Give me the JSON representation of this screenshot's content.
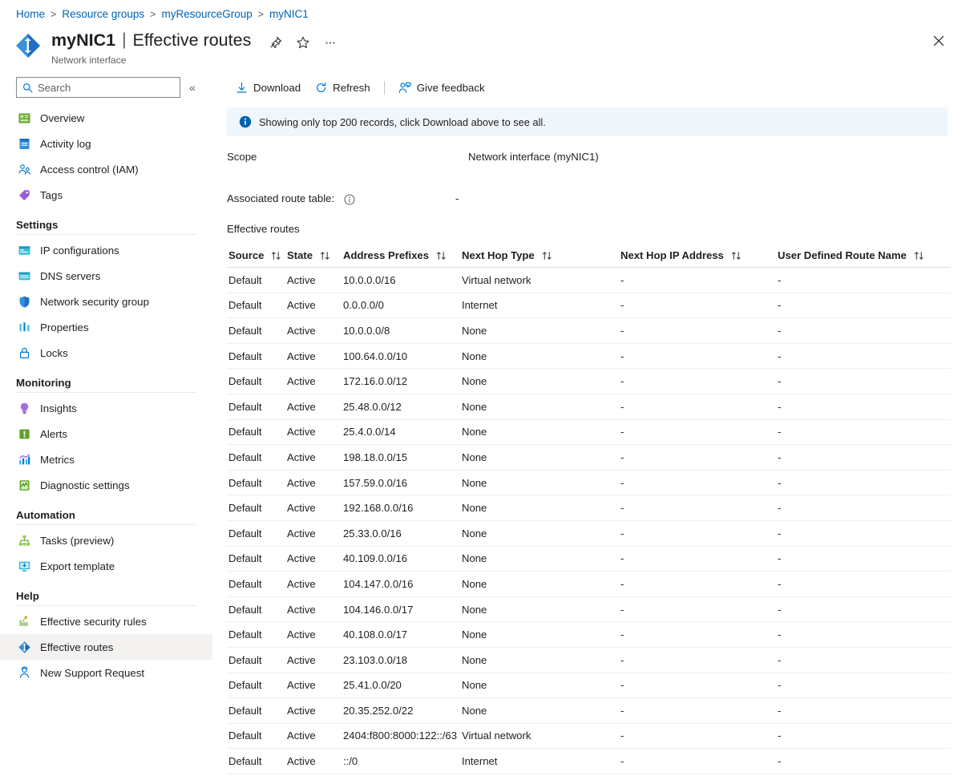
{
  "breadcrumb": {
    "items": [
      "Home",
      "Resource groups",
      "myResourceGroup",
      "myNIC1"
    ],
    "separator": ">"
  },
  "header": {
    "resource_name": "myNIC1",
    "separator": "|",
    "page_title": "Effective routes",
    "subtitle": "Network interface",
    "resource_icon": "network-interface-icon",
    "actions": [
      {
        "name": "pin-icon",
        "label": "Pin"
      },
      {
        "name": "favorite-star-icon",
        "label": "Add to favorites"
      },
      {
        "name": "more-ellipsis-icon",
        "label": "More"
      }
    ],
    "close_label": "Close"
  },
  "sidebar": {
    "search": {
      "placeholder": "Search",
      "value": "",
      "icon": "search-icon"
    },
    "collapse_icon": "chevron-double-left-icon",
    "items": [
      {
        "label": "Overview",
        "icon": "overview-icon",
        "type": "item",
        "selected": false
      },
      {
        "label": "Activity log",
        "icon": "activity-log-icon",
        "type": "item",
        "selected": false
      },
      {
        "label": "Access control (IAM)",
        "icon": "access-control-icon",
        "type": "item",
        "selected": false
      },
      {
        "label": "Tags",
        "icon": "tags-icon",
        "type": "item",
        "selected": false
      },
      {
        "label": "Settings",
        "type": "group"
      },
      {
        "label": "IP configurations",
        "icon": "ip-configurations-icon",
        "type": "item",
        "selected": false
      },
      {
        "label": "DNS servers",
        "icon": "dns-servers-icon",
        "type": "item",
        "selected": false
      },
      {
        "label": "Network security group",
        "icon": "shield-icon",
        "type": "item",
        "selected": false
      },
      {
        "label": "Properties",
        "icon": "properties-icon",
        "type": "item",
        "selected": false
      },
      {
        "label": "Locks",
        "icon": "lock-icon",
        "type": "item",
        "selected": false
      },
      {
        "label": "Monitoring",
        "type": "group"
      },
      {
        "label": "Insights",
        "icon": "insights-icon",
        "type": "item",
        "selected": false
      },
      {
        "label": "Alerts",
        "icon": "alerts-icon",
        "type": "item",
        "selected": false
      },
      {
        "label": "Metrics",
        "icon": "metrics-icon",
        "type": "item",
        "selected": false
      },
      {
        "label": "Diagnostic settings",
        "icon": "diagnostic-settings-icon",
        "type": "item",
        "selected": false
      },
      {
        "label": "Automation",
        "type": "group"
      },
      {
        "label": "Tasks (preview)",
        "icon": "tasks-icon",
        "type": "item",
        "selected": false
      },
      {
        "label": "Export template",
        "icon": "export-template-icon",
        "type": "item",
        "selected": false
      },
      {
        "label": "Help",
        "type": "group"
      },
      {
        "label": "Effective security rules",
        "icon": "effective-security-rules-icon",
        "type": "item",
        "selected": false
      },
      {
        "label": "Effective routes",
        "icon": "effective-routes-icon",
        "type": "item",
        "selected": true
      },
      {
        "label": "New Support Request",
        "icon": "support-request-icon",
        "type": "item",
        "selected": false
      }
    ]
  },
  "toolbar": {
    "download_label": "Download",
    "download_icon": "download-icon",
    "refresh_label": "Refresh",
    "refresh_icon": "refresh-icon",
    "feedback_label": "Give feedback",
    "feedback_icon": "feedback-person-icon"
  },
  "banner": {
    "icon": "info-icon",
    "text": "Showing only top 200 records, click Download above to see all."
  },
  "details": {
    "scope_label": "Scope",
    "scope_value": "Network interface (myNIC1)",
    "route_table_label": "Associated route table:",
    "route_table_info_icon": "info-outline-icon",
    "route_table_value": "-",
    "section_title": "Effective routes"
  },
  "table": {
    "columns": [
      {
        "label": "Source",
        "sort_icon": "sort-updown-icon"
      },
      {
        "label": "State",
        "sort_icon": "sort-updown-icon"
      },
      {
        "label": "Address Prefixes",
        "sort_icon": "sort-updown-icon"
      },
      {
        "label": "Next Hop Type",
        "sort_icon": "sort-updown-icon"
      },
      {
        "label": "Next Hop IP Address",
        "sort_icon": "sort-updown-icon"
      },
      {
        "label": "User Defined Route Name",
        "sort_icon": "sort-updown-icon"
      }
    ],
    "rows": [
      [
        "Default",
        "Active",
        "10.0.0.0/16",
        "Virtual network",
        "-",
        "-"
      ],
      [
        "Default",
        "Active",
        "0.0.0.0/0",
        "Internet",
        "-",
        "-"
      ],
      [
        "Default",
        "Active",
        "10.0.0.0/8",
        "None",
        "-",
        "-"
      ],
      [
        "Default",
        "Active",
        "100.64.0.0/10",
        "None",
        "-",
        "-"
      ],
      [
        "Default",
        "Active",
        "172.16.0.0/12",
        "None",
        "-",
        "-"
      ],
      [
        "Default",
        "Active",
        "25.48.0.0/12",
        "None",
        "-",
        "-"
      ],
      [
        "Default",
        "Active",
        "25.4.0.0/14",
        "None",
        "-",
        "-"
      ],
      [
        "Default",
        "Active",
        "198.18.0.0/15",
        "None",
        "-",
        "-"
      ],
      [
        "Default",
        "Active",
        "157.59.0.0/16",
        "None",
        "-",
        "-"
      ],
      [
        "Default",
        "Active",
        "192.168.0.0/16",
        "None",
        "-",
        "-"
      ],
      [
        "Default",
        "Active",
        "25.33.0.0/16",
        "None",
        "-",
        "-"
      ],
      [
        "Default",
        "Active",
        "40.109.0.0/16",
        "None",
        "-",
        "-"
      ],
      [
        "Default",
        "Active",
        "104.147.0.0/16",
        "None",
        "-",
        "-"
      ],
      [
        "Default",
        "Active",
        "104.146.0.0/17",
        "None",
        "-",
        "-"
      ],
      [
        "Default",
        "Active",
        "40.108.0.0/17",
        "None",
        "-",
        "-"
      ],
      [
        "Default",
        "Active",
        "23.103.0.0/18",
        "None",
        "-",
        "-"
      ],
      [
        "Default",
        "Active",
        "25.41.0.0/20",
        "None",
        "-",
        "-"
      ],
      [
        "Default",
        "Active",
        "20.35.252.0/22",
        "None",
        "-",
        "-"
      ],
      [
        "Default",
        "Active",
        "2404:f800:8000:122::/63",
        "Virtual network",
        "-",
        "-"
      ],
      [
        "Default",
        "Active",
        "::/0",
        "Internet",
        "-",
        "-"
      ]
    ]
  },
  "colors": {
    "link": "#0063b1",
    "accent": "#0078d4",
    "banner_bg": "#eff6fc",
    "selected_bg": "#f3f2f1",
    "text": "#201f1e",
    "muted": "#605e5c"
  }
}
